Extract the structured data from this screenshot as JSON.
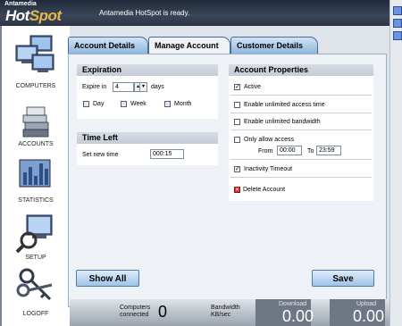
{
  "app": {
    "logo_small": "Antamedia",
    "logo_hot": "Hot",
    "logo_spot": "Spot",
    "status": "Antamedia HotSpot is ready."
  },
  "sidebar": {
    "items": [
      {
        "label": "COMPUTERS",
        "icon": "computers-icon"
      },
      {
        "label": "ACCOUNTS",
        "icon": "accounts-icon"
      },
      {
        "label": "STATISTICS",
        "icon": "statistics-icon"
      },
      {
        "label": "SETUP",
        "icon": "setup-icon"
      },
      {
        "label": "LOGOFF",
        "icon": "keys-icon"
      }
    ]
  },
  "tabs": [
    {
      "label": "Account Details",
      "active": false
    },
    {
      "label": "Manage Account",
      "active": true
    },
    {
      "label": "Customer Details",
      "active": false
    }
  ],
  "expiration": {
    "title": "Expiration",
    "expire_in_label": "Expire in",
    "expire_value": "4",
    "unit_label": "days",
    "options": [
      "Day",
      "Week",
      "Month"
    ]
  },
  "time_left": {
    "title": "Time Left",
    "set_label": "Set new time",
    "value": "000:15"
  },
  "properties": {
    "title": "Account Properties",
    "active": {
      "label": "Active",
      "checked": true
    },
    "unlimited_access": {
      "label": "Enable unlimited access time",
      "checked": false
    },
    "unlimited_bandwidth": {
      "label": "Enable unlimited bandwidth",
      "checked": false
    },
    "only_allow": {
      "label": "Only allow access",
      "checked": false,
      "from_label": "From",
      "from_value": "00:00",
      "to_label": "To",
      "to_value": "23:59"
    },
    "inactivity": {
      "label": "Inactivity Timeout",
      "checked": true
    },
    "delete_label": "Delete Account"
  },
  "buttons": {
    "show_all": "Show All",
    "save": "Save"
  },
  "footer": {
    "computers_label_1": "Computers",
    "computers_label_2": "connected",
    "computers_value": "0",
    "bandwidth_label_1": "Bandwidth",
    "bandwidth_label_2": "KB/sec",
    "download_label": "Download",
    "download_value": "0.00",
    "upload_label": "Upload",
    "upload_value": "0.00"
  },
  "colors": {
    "accent": "#9fc3e8",
    "delete_icon": "#d42a2a",
    "title_bar": "#2c3546"
  }
}
